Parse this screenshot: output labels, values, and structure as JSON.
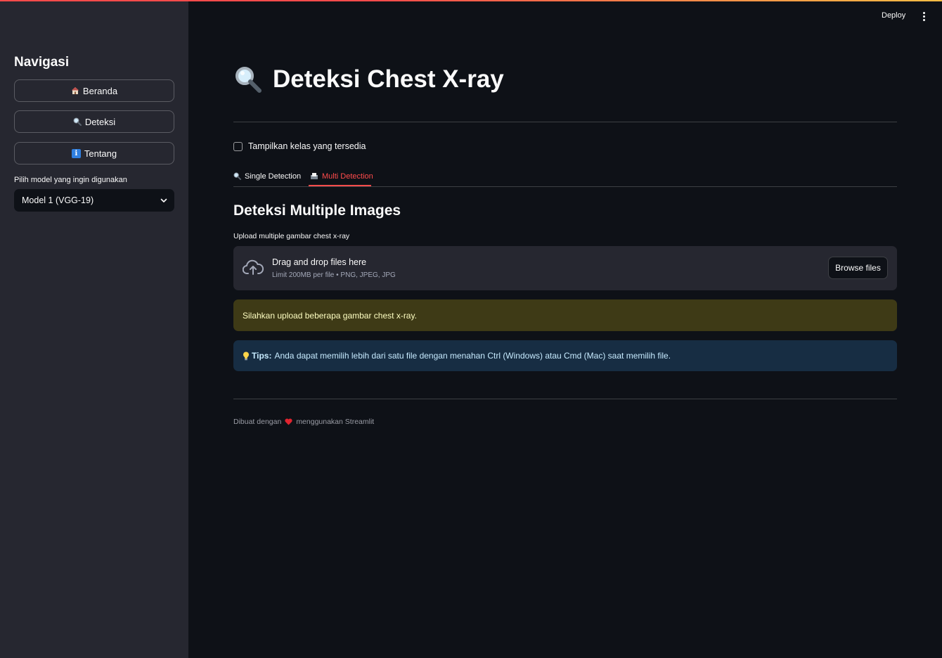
{
  "colors": {
    "accent": "#ff4b4b",
    "background": "#0e1117",
    "sidebar": "#262730",
    "warning_bg": "#3e3a16",
    "info_bg": "#172d43"
  },
  "header": {
    "deploy_label": "Deploy",
    "menu_icon": "kebab-menu-icon"
  },
  "sidebar": {
    "title": "Navigasi",
    "items": [
      {
        "label": "Beranda",
        "icon": "house-icon"
      },
      {
        "label": "Deteksi",
        "icon": "magnifier-icon"
      },
      {
        "label": "Tentang",
        "icon": "info-icon"
      }
    ],
    "select_label": "Pilih model yang ingin digunakan",
    "select_value": "Model 1 (VGG-19)"
  },
  "main": {
    "title": "Deteksi Chest X-ray",
    "checkbox_label": "Tampilkan kelas yang tersedia",
    "tabs": [
      {
        "label": "Single Detection",
        "icon": "magnifier-icon"
      },
      {
        "label": "Multi Detection",
        "icon": "inbox-tray-icon",
        "active": true
      }
    ],
    "section_title": "Deteksi Multiple Images",
    "upload_label": "Upload multiple gambar chest x-ray",
    "dropzone": {
      "main_text": "Drag and drop files here",
      "sub_text": "Limit 200MB per file • PNG, JPEG, JPG",
      "button_label": "Browse files"
    },
    "warning_text": "Silahkan upload beberapa gambar chest x-ray.",
    "info": {
      "bold": "Tips:",
      "text": "Anda dapat memilih lebih dari satu file dengan menahan Ctrl (Windows) atau Cmd (Mac) saat memilih file."
    },
    "footer": {
      "before": "Dibuat dengan",
      "after": "menggunakan Streamlit"
    }
  }
}
